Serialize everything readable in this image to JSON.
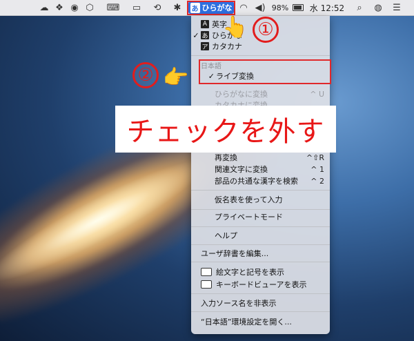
{
  "menubar": {
    "ime_label": "ひらがな",
    "ime_prefix": "あ",
    "battery": "98%",
    "time": "水 12:52"
  },
  "menu": {
    "input_modes": [
      {
        "icon": "A",
        "label": "英字",
        "checked": false
      },
      {
        "icon": "あ",
        "label": "ひらがな",
        "checked": true
      },
      {
        "icon": "ア",
        "label": "カタカナ",
        "checked": false
      }
    ],
    "section_japanese": "日本語",
    "live_conversion": "ライブ変換",
    "convert_hiragana": "ひらがなに変換",
    "convert_hiragana_sc": "^ U",
    "convert_katakana": "カタカナに変換",
    "reconvert": "再変換",
    "reconvert_sc": "^⇧R",
    "related_chars": "関連文字に変換",
    "related_chars_sc": "^ 1",
    "radical_search": "部品の共通な漢字を検索",
    "radical_search_sc": "^ 2",
    "kana_table": "仮名表を使って入力",
    "private_mode": "プライベートモード",
    "help": "ヘルプ",
    "edit_dictionary": "ユーザ辞書を編集...",
    "show_emoji": "絵文字と記号を表示",
    "show_keyboard_viewer": "キーボードビューアを表示",
    "hide_input_source": "入力ソース名を非表示",
    "open_prefs": "“日本語”環境設定を開く..."
  },
  "annotations": {
    "step1": "①",
    "step2": "②",
    "banner": "チェックを外す"
  }
}
